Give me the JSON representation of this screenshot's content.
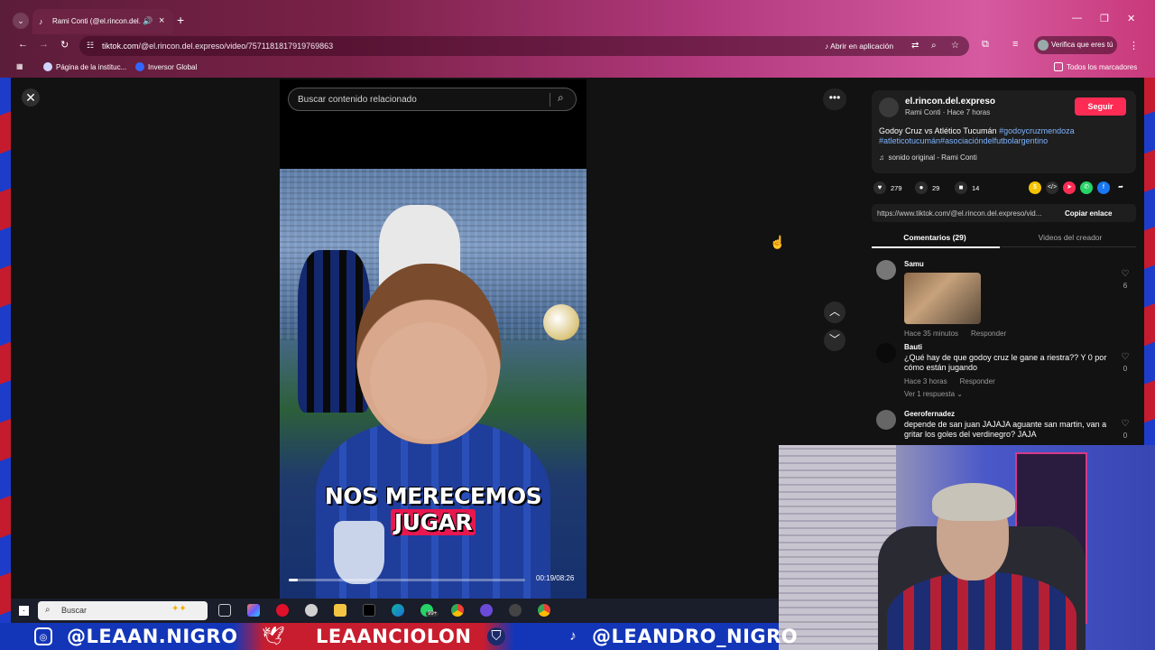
{
  "browser": {
    "tab_title": "Rami Conti (@el.rincon.del.",
    "url_host": "tiktok.com",
    "url_path": "/@el.rincon.del.expreso/video/7571181817919769863",
    "open_in_app": "Abrir en aplicación",
    "verify_label": "Verifica que eres tú",
    "bookmarks": [
      "Página de la instituc...",
      "Inversor Global"
    ],
    "all_bookmarks": "Todos los marcadores"
  },
  "page": {
    "search_placeholder": "Buscar contenido relacionado",
    "video": {
      "caption_part1": "NOS MERECEMOS ",
      "caption_highlight": "JUGAR",
      "time": "00:19/08:26",
      "progress": 0.038
    }
  },
  "panel": {
    "creator": "el.rincon.del.expreso",
    "subtitle": "Rami Conti · Hace 7 horas",
    "follow": "Seguir",
    "desc_text": "Godoy Cruz vs Atlético Tucumán ",
    "tag1": "#godoycruzmendoza",
    "tag2": "#atleticotucumán",
    "tag3": "#asociacióndelfutbolargentino",
    "music": "sonido original - Rami Conti",
    "likes": "279",
    "comments_count": "29",
    "saves": "14",
    "link": "https://www.tiktok.com/@el.rincon.del.expreso/vid...",
    "copy_link": "Copiar enlace",
    "tab_comments": "Comentarios (29)",
    "tab_creator": "Videos del creador",
    "comments": [
      {
        "user": "Samu",
        "text": "",
        "time": "Hace 35 minutos",
        "reply": "Responder",
        "likes": "6"
      },
      {
        "user": "Bauti",
        "text": "¿Qué hay de que godoy cruz le gane a riestra?? Y 0 por cómo están jugando",
        "time": "Hace 3 horas",
        "reply": "Responder",
        "likes": "0",
        "more": "Ver 1 respuesta"
      },
      {
        "user": "Geerofernadez",
        "text": "depende de san juan JAJAJA aguante san martin, van a gritar los goles del verdinegro? JAJA",
        "likes": "0"
      }
    ]
  },
  "taskbar": {
    "search": "Buscar",
    "badge": "99+"
  },
  "banner": {
    "left": "@LEAAN.NIGRO",
    "center": "LEAANCIOLON",
    "right": "@LEANDRO_NIGRO"
  },
  "colors": {
    "follow": "#fe2c55",
    "hashtag": "#7fb4ff",
    "banner_blue": "#1336b8",
    "banner_red": "#c81d2e"
  }
}
